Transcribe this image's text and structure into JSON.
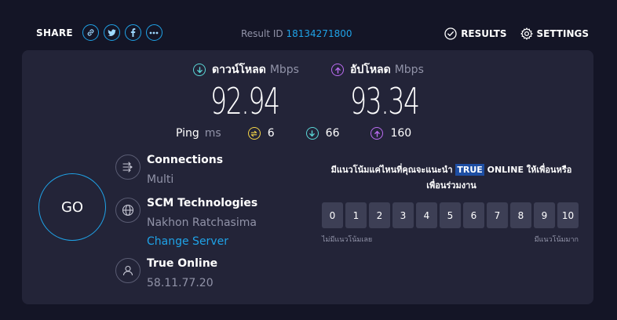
{
  "header": {
    "share_label": "SHARE",
    "result_id_label": "Result ID",
    "result_id_value": "18134271800",
    "results_label": "RESULTS",
    "settings_label": "SETTINGS"
  },
  "speeds": {
    "download": {
      "label": "ดาวน์โหลด",
      "unit": "Mbps",
      "value": "92.94",
      "icon": "download-arrow-icon",
      "color": "#5ad6d6"
    },
    "upload": {
      "label": "อัปโหลด",
      "unit": "Mbps",
      "value": "93.34",
      "icon": "upload-arrow-icon",
      "color": "#bb6cf2"
    }
  },
  "ping": {
    "label": "Ping",
    "unit": "ms",
    "idle": "6",
    "download": "66",
    "upload": "160",
    "idle_color": "#f5d547"
  },
  "go_label": "GO",
  "connections": {
    "title": "Connections",
    "value": "Multi"
  },
  "server": {
    "title": "SCM Technologies",
    "location": "Nakhon Ratchasima",
    "change_label": "Change Server"
  },
  "isp": {
    "title": "True Online",
    "ip": "58.11.77.20"
  },
  "survey": {
    "question_before": "มีแนวโน้มแค่ไหนที่คุณจะแนะนำ ",
    "question_highlight": "TRUE",
    "question_after": " ONLINE ให้เพื่อนหรือ",
    "question_line2": "เพื่อนร่วมงาน",
    "scale": [
      "0",
      "1",
      "2",
      "3",
      "4",
      "5",
      "6",
      "7",
      "8",
      "9",
      "10"
    ],
    "low_label": "ไม่มีแนวโน้มเลย",
    "high_label": "มีแนวโน้มมาก"
  },
  "colors": {
    "accent": "#1fa3e8",
    "background": "#141526",
    "panel": "#232438"
  }
}
